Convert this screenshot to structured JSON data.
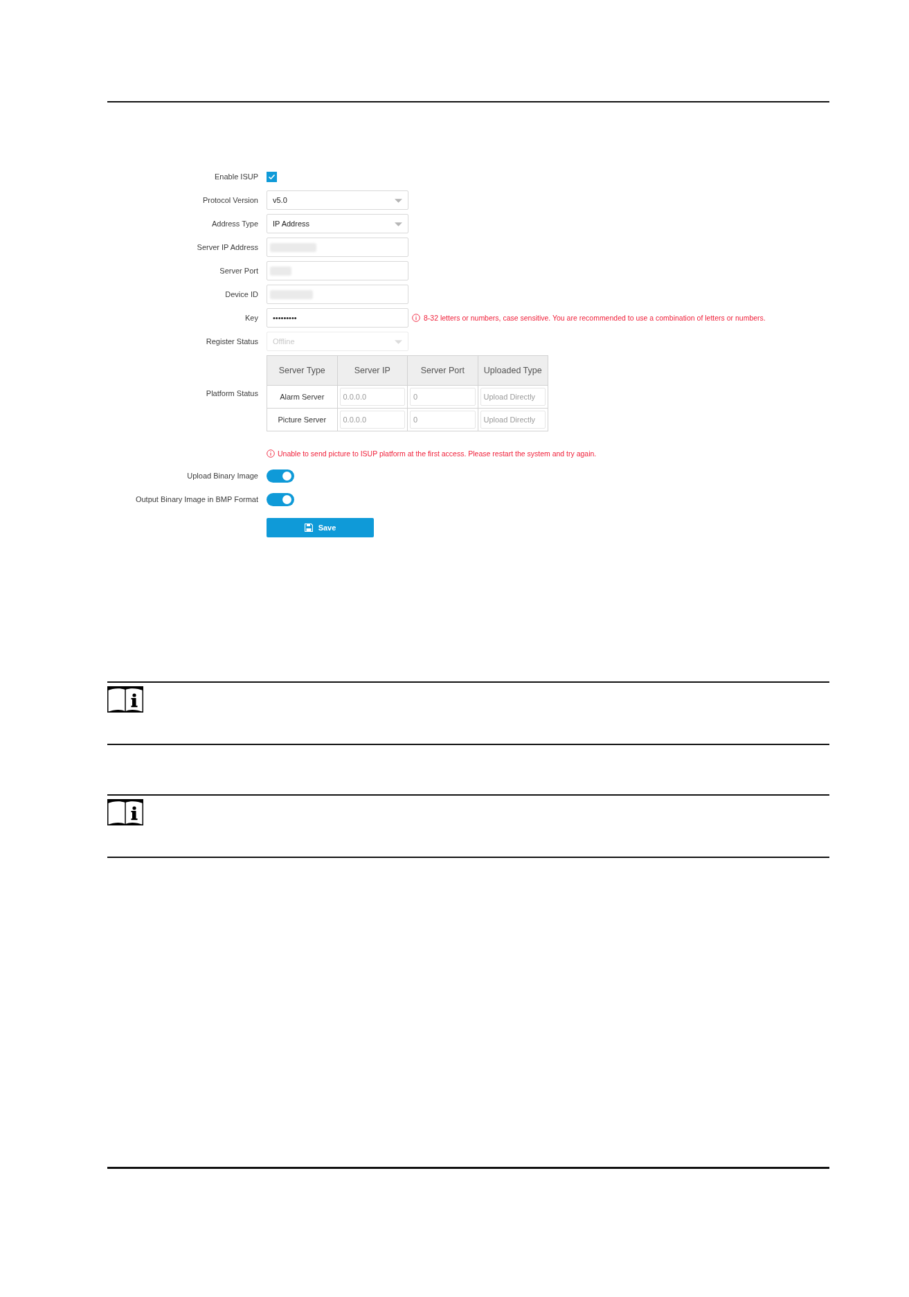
{
  "form": {
    "fields": [
      {
        "kind": "checkbox",
        "label": "Enable ISUP",
        "checked": true
      },
      {
        "kind": "select",
        "label": "Protocol Version",
        "value": "v5.0",
        "disabled": false
      },
      {
        "kind": "select",
        "label": "Address Type",
        "value": "IP Address",
        "disabled": false
      },
      {
        "kind": "text",
        "label": "Server IP Address",
        "redacted": true
      },
      {
        "kind": "text",
        "label": "Server Port",
        "redacted": true
      },
      {
        "kind": "text",
        "label": "Device ID",
        "redacted": true
      },
      {
        "kind": "text",
        "label": "Key",
        "value": "•••••••••",
        "hint": "8-32 letters or numbers, case sensitive. You are recommended to use a combination of letters or numbers."
      },
      {
        "kind": "select",
        "label": "Register Status",
        "value": "Offline",
        "disabled": true
      }
    ],
    "platform_status": {
      "label": "Platform Status",
      "columns": [
        "Server Type",
        "Server IP",
        "Server Port",
        "Uploaded Type"
      ],
      "rows": [
        {
          "server_type": "Alarm Server",
          "server_ip": "0.0.0.0",
          "server_port": "0",
          "uploaded_type": "Upload Directly"
        },
        {
          "server_type": "Picture Server",
          "server_ip": "0.0.0.0",
          "server_port": "0",
          "uploaded_type": "Upload Directly"
        }
      ],
      "warning": "Unable to send picture to ISUP platform at the first access. Please restart the system and try again."
    },
    "toggles": [
      {
        "label": "Upload Binary Image",
        "on": true
      },
      {
        "label": "Output Binary Image in BMP Format",
        "on": true
      }
    ],
    "save_button": {
      "label": "Save"
    }
  },
  "notes": [
    {
      "kind": "note"
    },
    {
      "kind": "note"
    }
  ]
}
